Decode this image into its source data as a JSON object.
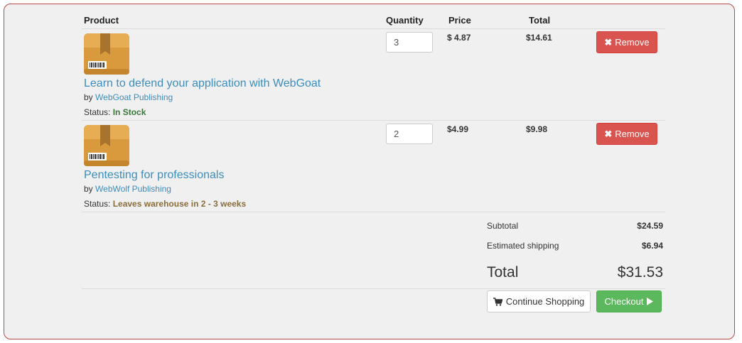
{
  "header": {
    "product": "Product",
    "quantity": "Quantity",
    "price": "Price",
    "total": "Total"
  },
  "items": [
    {
      "icon": "package-box-icon",
      "title": "Learn to defend your application with WebGoat",
      "by": "by",
      "publisher": "WebGoat Publishing",
      "status_label": "Status:",
      "status": "In Stock",
      "status_color": "#3c763d",
      "quantity": "3",
      "price": "$ 4.87",
      "total": "$14.61",
      "remove_label": "Remove"
    },
    {
      "icon": "package-box-icon",
      "title": "Pentesting for professionals",
      "by": "by",
      "publisher": "WebWolf Publishing",
      "status_label": "Status:",
      "status": "Leaves warehouse in 2 - 3 weeks",
      "status_color": "#8a6d3b",
      "quantity": "2",
      "price": "$4.99",
      "total": "$9.98",
      "remove_label": "Remove"
    }
  ],
  "summary": {
    "subtotal_label": "Subtotal",
    "subtotal": "$24.59",
    "shipping_label": "Estimated shipping",
    "shipping": "$6.94",
    "total_label": "Total",
    "total": "$31.53"
  },
  "actions": {
    "continue_label": "Continue Shopping",
    "checkout_label": "Checkout"
  },
  "colors": {
    "panel_border": "#b94a48",
    "link": "#3c8dbc",
    "remove": "#d9534f",
    "checkout": "#5cb85c"
  }
}
